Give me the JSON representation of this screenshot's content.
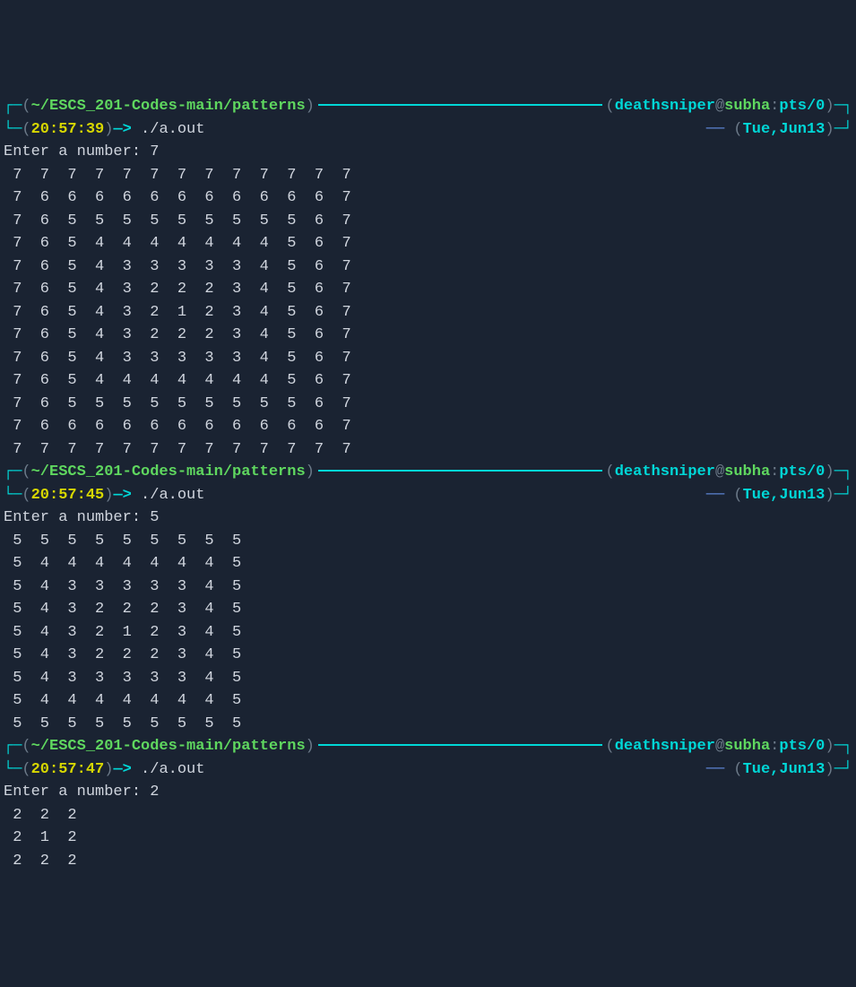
{
  "blocks": [
    {
      "path": "~/ESCS_201-Codes-main/patterns",
      "user": "deathsniper",
      "host": "subha",
      "tty": "pts/0",
      "time": "20:57:39",
      "date": "Tue,Jun13",
      "arrow": "—>",
      "command": "./a.out",
      "prompt_label": "Enter a number: ",
      "input": "7",
      "output": " 7  7  7  7  7  7  7  7  7  7  7  7  7 \n 7  6  6  6  6  6  6  6  6  6  6  6  7 \n 7  6  5  5  5  5  5  5  5  5  5  6  7 \n 7  6  5  4  4  4  4  4  4  4  5  6  7 \n 7  6  5  4  3  3  3  3  3  4  5  6  7 \n 7  6  5  4  3  2  2  2  3  4  5  6  7 \n 7  6  5  4  3  2  1  2  3  4  5  6  7 \n 7  6  5  4  3  2  2  2  3  4  5  6  7 \n 7  6  5  4  3  3  3  3  3  4  5  6  7 \n 7  6  5  4  4  4  4  4  4  4  5  6  7 \n 7  6  5  5  5  5  5  5  5  5  5  6  7 \n 7  6  6  6  6  6  6  6  6  6  6  6  7 \n 7  7  7  7  7  7  7  7  7  7  7  7  7 "
    },
    {
      "path": "~/ESCS_201-Codes-main/patterns",
      "user": "deathsniper",
      "host": "subha",
      "tty": "pts/0",
      "time": "20:57:45",
      "date": "Tue,Jun13",
      "arrow": "—>",
      "command": "./a.out",
      "prompt_label": "Enter a number: ",
      "input": "5",
      "output": " 5  5  5  5  5  5  5  5  5 \n 5  4  4  4  4  4  4  4  5 \n 5  4  3  3  3  3  3  4  5 \n 5  4  3  2  2  2  3  4  5 \n 5  4  3  2  1  2  3  4  5 \n 5  4  3  2  2  2  3  4  5 \n 5  4  3  3  3  3  3  4  5 \n 5  4  4  4  4  4  4  4  5 \n 5  5  5  5  5  5  5  5  5 "
    },
    {
      "path": "~/ESCS_201-Codes-main/patterns",
      "user": "deathsniper",
      "host": "subha",
      "tty": "pts/0",
      "time": "20:57:47",
      "date": "Tue,Jun13",
      "arrow": "—>",
      "command": "./a.out",
      "prompt_label": "Enter a number: ",
      "input": "2",
      "output": " 2  2  2 \n 2  1  2 \n 2  2  2 "
    }
  ]
}
